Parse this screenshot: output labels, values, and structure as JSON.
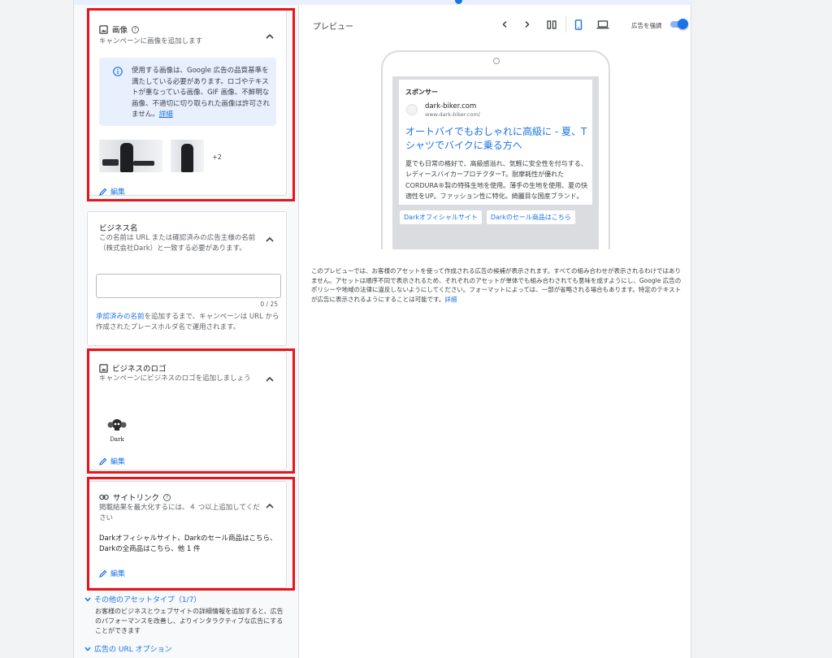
{
  "images_card": {
    "title": "画像",
    "subtitle": "キャンペーンに画像を追加します",
    "info": "使用する画像は、Google 広告の品質基準を満たしている必要があります。ロゴやテキストが重なっている画像、GIF 画像、不鮮明な画像、不適切に切り取られた画像は許可されません。",
    "info_link": "詳細",
    "more_count": "+2",
    "edit_label": "編集"
  },
  "business_card": {
    "title": "ビジネス名",
    "subtitle": "この名前は URL または確認済みの広告主様の名前（株式会社Dark）と一致する必要があります。",
    "input_value": "",
    "counter": "0 / 25",
    "note_link": "承認済みの名前",
    "note_text": "を追加するまで、キャンペーンは URL から作成されたプレースホルダ名で運用されます。"
  },
  "logo_card": {
    "title": "ビジネスのロゴ",
    "subtitle": "キャンペーンにビジネスのロゴを追加しましょう",
    "logo_text": "Dark",
    "edit_label": "編集"
  },
  "sitelink_card": {
    "title": "サイトリンク",
    "subtitle": "掲載結果を最大化するには、４ つ以上追加してください",
    "summary": "Darkオフィシャルサイト、Darkのセール商品はこちら、Darkの全商品はこちら、他 1 件",
    "edit_label": "編集"
  },
  "other_assets": {
    "label": "その他のアセットタイプ（1/7）",
    "desc": "お客様のビジネスとウェブサイトの詳細情報を追加すると、広告のパフォーマンスを改善し、よりインタラクティブな広告にすることができます"
  },
  "url_options": {
    "label": "広告の URL オプション"
  },
  "preview": {
    "title": "プレビュー",
    "toggle_label": "広告を強調",
    "toggle_on": true,
    "ad": {
      "sponsor": "スポンサー",
      "site": "dark-biker.com",
      "url": "www.dark-biker.com/",
      "headline": "オートバイでもおしゃれに高級に - 夏、Tシャツでバイクに乗る方へ",
      "description": "夏でも日常の格好で、高級感溢れ、気軽に安全性を付与する、レディースバイカープロテクターT。耐摩耗性が優れたCORDURA®製の特殊生地を使用。薄手の生地を使用、夏の快適性をUP。ファッション性に特化。綺麗目な国産ブランド。",
      "sitelinks": [
        "Darkオフィシャルサイト",
        "Darkのセール商品はこちら"
      ]
    },
    "note": "このプレビューでは、お客様のアセットを使って作成される広告の候補が表示されます。すべての組み合わせが表示されるわけではありません。アセットは順序不同で表示されるため、それぞれのアセットが単体でも組み合わされても意味を成すようにし、Google 広告のポリシーや地域の法律に違反しないようにしてください。フォーマットによっては、一部が省略される場合もあります。特定のテキストが広告に表示されるようにすることは可能です。",
    "note_link": "詳細"
  },
  "colors": {
    "accent": "#1a73e8",
    "highlight_box": "#e8141a",
    "info_bg": "#e8f0fe"
  }
}
